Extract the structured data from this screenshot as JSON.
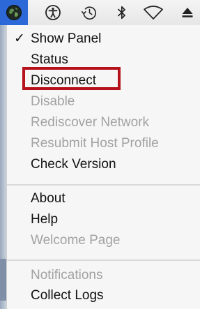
{
  "menubar": {
    "icons": [
      {
        "name": "app-globe-icon",
        "active": true
      },
      {
        "name": "accessibility-icon",
        "active": false
      },
      {
        "name": "time-machine-icon",
        "active": false
      },
      {
        "name": "bluetooth-icon",
        "active": false
      },
      {
        "name": "wifi-icon",
        "active": false
      },
      {
        "name": "eject-icon",
        "active": false
      }
    ],
    "accent_color": "#2d68d8"
  },
  "menu": {
    "checkmark": "✓",
    "items": [
      {
        "label": "Show Panel",
        "enabled": true,
        "checked": true
      },
      {
        "label": "Status",
        "enabled": true,
        "checked": false
      },
      {
        "label": "Disconnect",
        "enabled": true,
        "checked": false,
        "highlighted": true
      },
      {
        "label": "Disable",
        "enabled": false,
        "checked": false
      },
      {
        "label": "Rediscover Network",
        "enabled": false,
        "checked": false
      },
      {
        "label": "Resubmit Host Profile",
        "enabled": false,
        "checked": false
      },
      {
        "label": "Check Version",
        "enabled": true,
        "checked": false
      },
      {
        "label": "About",
        "enabled": true,
        "checked": false
      },
      {
        "label": "Help",
        "enabled": true,
        "checked": false
      },
      {
        "label": "Welcome Page",
        "enabled": false,
        "checked": false
      },
      {
        "label": "Notifications",
        "enabled": false,
        "checked": false
      },
      {
        "label": "Collect Logs",
        "enabled": true,
        "checked": false
      }
    ],
    "highlight_color": "#b5121b",
    "disabled_color": "#a2a2a2"
  }
}
